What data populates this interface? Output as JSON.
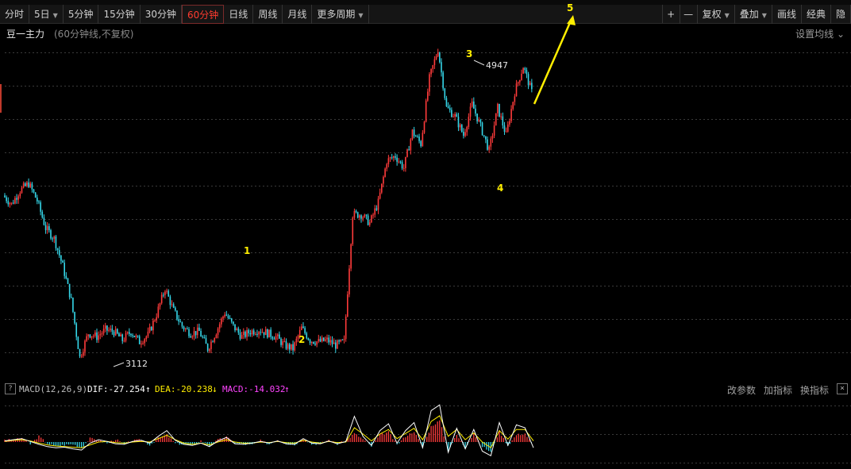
{
  "toolbar": {
    "buttons": [
      {
        "label": "分时",
        "dropdown": false,
        "active": false
      },
      {
        "label": "5日",
        "dropdown": true,
        "active": false
      },
      {
        "label": "5分钟",
        "dropdown": false,
        "active": false
      },
      {
        "label": "15分钟",
        "dropdown": false,
        "active": false
      },
      {
        "label": "30分钟",
        "dropdown": false,
        "active": false
      },
      {
        "label": "60分钟",
        "dropdown": false,
        "active": true
      },
      {
        "label": "日线",
        "dropdown": false,
        "active": false
      },
      {
        "label": "周线",
        "dropdown": false,
        "active": false
      },
      {
        "label": "月线",
        "dropdown": false,
        "active": false
      },
      {
        "label": "更多周期",
        "dropdown": true,
        "active": false
      }
    ],
    "right_buttons": [
      {
        "label": "+",
        "dropdown": false,
        "icon": "zoom-in-icon"
      },
      {
        "label": "—",
        "dropdown": false,
        "icon": "zoom-out-icon"
      },
      {
        "label": "复权",
        "dropdown": true
      },
      {
        "label": "叠加",
        "dropdown": true
      },
      {
        "label": "画线",
        "dropdown": false
      },
      {
        "label": "经典",
        "dropdown": false
      },
      {
        "label": "隐",
        "dropdown": false
      }
    ]
  },
  "info": {
    "title": "豆一主力",
    "subtitle": "(60分钟线,不复权)",
    "set_ma": "设置均线",
    "set_ma_caret": "⌄"
  },
  "macd": {
    "help": "?",
    "name": "MACD(12,26,9)",
    "dif": "DIF:-27.254",
    "dif_arrow": "↑",
    "dea": "DEA:-20.238",
    "dea_arrow": "↓",
    "macd": "MACD:-14.032",
    "macd_arrow": "↑",
    "links": [
      "改参数",
      "加指标",
      "换指标"
    ],
    "close": "×"
  },
  "colors": {
    "up": "#ff3b3b",
    "down": "#35d6e8",
    "annotation": "#ffee00",
    "dif": "#ffffff",
    "dea": "#ffee00",
    "macd_text": "#ff44ff",
    "grid": "#3a3a3a"
  },
  "chart_data": {
    "type": "candlestick",
    "interval": "60分钟",
    "price_labels": {
      "high": "4947",
      "low": "3112"
    },
    "wave_labels": [
      "1",
      "2",
      "3",
      "4",
      "5"
    ],
    "close_series": [
      4090,
      4040,
      4120,
      4160,
      4060,
      3900,
      3840,
      3680,
      3480,
      3150,
      3290,
      3270,
      3310,
      3300,
      3250,
      3300,
      3240,
      3280,
      3400,
      3550,
      3420,
      3330,
      3290,
      3300,
      3200,
      3300,
      3410,
      3330,
      3270,
      3300,
      3310,
      3290,
      3270,
      3220,
      3200,
      3320,
      3250,
      3240,
      3250,
      3220,
      3240,
      3980,
      3980,
      3930,
      4050,
      4290,
      4320,
      4250,
      4460,
      4390,
      4770,
      4940,
      4600,
      4550,
      4440,
      4620,
      4490,
      4350,
      4600,
      4440,
      4690,
      4840,
      4690
    ],
    "macd_hist": [
      4,
      2,
      6,
      -3,
      8,
      -2,
      -6,
      -4,
      -3,
      -8,
      5,
      3,
      -2,
      4,
      -3,
      2,
      3,
      -4,
      5,
      10,
      -2,
      -3,
      -5,
      2,
      -6,
      3,
      7,
      -2,
      -3,
      -4,
      2,
      -3,
      3,
      -2,
      -4,
      5,
      -3,
      -2,
      3,
      -3,
      2,
      12,
      4,
      -6,
      10,
      14,
      -4,
      8,
      15,
      -8,
      22,
      30,
      -12,
      10,
      -8,
      12,
      -6,
      -14,
      15,
      -5,
      10,
      12,
      -6
    ],
    "dif_series": [
      2,
      4,
      6,
      1,
      -4,
      -8,
      -10,
      -9,
      -12,
      -14,
      -2,
      4,
      1,
      -3,
      -4,
      1,
      3,
      -2,
      10,
      20,
      3,
      -4,
      -6,
      -2,
      -8,
      2,
      8,
      -3,
      -4,
      -2,
      1,
      -2,
      2,
      -3,
      -4,
      6,
      -2,
      -3,
      2,
      -3,
      1,
      45,
      10,
      -6,
      20,
      32,
      -2,
      20,
      34,
      -10,
      55,
      65,
      -18,
      24,
      -12,
      22,
      -16,
      -24,
      34,
      -6,
      30,
      25,
      -10
    ],
    "dea_series": [
      1,
      3,
      4,
      2,
      -2,
      -5,
      -7,
      -8,
      -9,
      -10,
      -5,
      0,
      1,
      -1,
      -2,
      0,
      1,
      0,
      6,
      12,
      4,
      -2,
      -4,
      -2,
      -5,
      0,
      4,
      0,
      -2,
      -2,
      0,
      -1,
      1,
      -1,
      -2,
      3,
      0,
      -2,
      1,
      -1,
      0,
      25,
      14,
      2,
      14,
      22,
      6,
      15,
      24,
      4,
      36,
      46,
      10,
      22,
      4,
      16,
      0,
      -10,
      20,
      5,
      22,
      22,
      2
    ]
  }
}
